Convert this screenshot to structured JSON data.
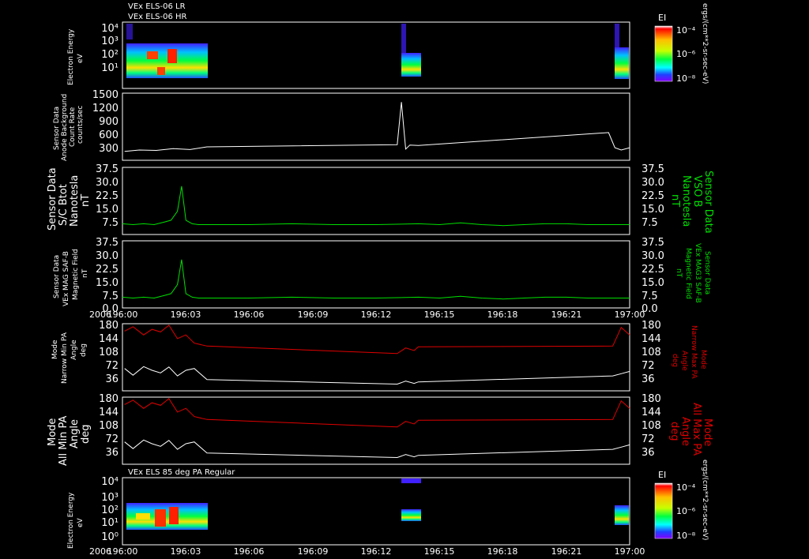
{
  "header": {
    "line1": "VEx ELS-06 LR",
    "line2": "VEx ELS-06 HR"
  },
  "spectro2_title": "VEx ELS 85 deg PA Regular",
  "xaxis": {
    "year": "2006",
    "ticks": [
      "196:00",
      "196:03",
      "196:06",
      "196:09",
      "196:12",
      "196:15",
      "196:18",
      "196:21",
      "197:00"
    ]
  },
  "colorbar": {
    "label": "EI",
    "units": "ergs/(cm**2-sr-sec-eV)",
    "ticks": [
      "10⁻⁴",
      "10⁻⁶",
      "10⁻⁸"
    ]
  },
  "panels": {
    "spec1": {
      "ylabel": [
        "Electron Energy",
        "eV"
      ],
      "yticks": [
        "10⁴",
        "10³",
        "10²",
        "10¹",
        "10"
      ]
    },
    "sensor": {
      "ylabel": [
        "Sensor Data",
        "Anode Background",
        "Count Rate",
        "counts/sec"
      ],
      "yticks": [
        "1500",
        "1200",
        "900",
        "600",
        "300"
      ]
    },
    "bmag1": {
      "ylabel_left": [
        "Sensor Data",
        "S/C Btot",
        "Nanotesla",
        "nT"
      ],
      "ylabel_right": [
        "Sensor Data",
        "VSO B",
        "Nanotesla",
        "nT"
      ],
      "yticks": [
        "37.5",
        "30.0",
        "22.5",
        "15.0",
        "7.5"
      ]
    },
    "bmag2": {
      "ylabel_left": [
        "Sensor Data",
        "VEx MAG SAF-B",
        "Magnetic Field",
        "nT"
      ],
      "ylabel_right": [
        "Sensor Data",
        "VEx MAG3 SAF-B",
        "Magnetic Field",
        "nT"
      ],
      "yticks": [
        "37.5",
        "30.0",
        "22.5",
        "15.0",
        "7.5",
        "0.0"
      ]
    },
    "pa1": {
      "ylabel_left": [
        "Mode",
        "Narrow Min PA",
        "Angle",
        "deg"
      ],
      "ylabel_right": [
        "Mode",
        "Narrow Max PA",
        "Angle",
        "deg"
      ],
      "yticks": [
        "180",
        "144",
        "108",
        "72",
        "36"
      ]
    },
    "pa2": {
      "ylabel_left": [
        "Mode",
        "All Min PA",
        "Angle",
        "deg"
      ],
      "ylabel_right": [
        "Mode",
        "All Max PA",
        "Angle",
        "deg"
      ],
      "yticks": [
        "180",
        "144",
        "108",
        "72",
        "36"
      ]
    },
    "spec2": {
      "ylabel": [
        "Electron Energy",
        "eV"
      ],
      "yticks": [
        "10⁴",
        "10³",
        "10²",
        "10¹",
        "10⁰"
      ]
    }
  },
  "colors": {
    "green": "#00e000",
    "red": "#e00000",
    "white": "#ffffff"
  },
  "chart_data": {
    "type": "line",
    "time_range_hours": [
      0,
      24
    ],
    "series_btot": {
      "x": [
        0,
        0.5,
        1,
        1.5,
        2,
        2.3,
        2.6,
        2.8,
        3,
        3.3,
        3.6,
        4,
        6,
        8,
        10,
        12,
        14,
        15,
        16,
        17,
        18,
        19,
        20,
        21,
        22,
        23,
        24
      ],
      "y": [
        6,
        5.5,
        6,
        5.5,
        7,
        8,
        13,
        27,
        8,
        6,
        5.5,
        5.5,
        5.5,
        6,
        5.5,
        5.5,
        6,
        5.5,
        6.5,
        5.5,
        5,
        5.5,
        6,
        6,
        5.5,
        5.5,
        5.5
      ],
      "ylim": [
        0,
        37.5
      ]
    },
    "series_counts": {
      "x": [
        0.1,
        0.8,
        1.6,
        2.4,
        3.2,
        4.0,
        13.0,
        13.2,
        13.4,
        13.6,
        14.0,
        23.0,
        23.3,
        23.6,
        24
      ],
      "y": [
        200,
        230,
        220,
        260,
        240,
        300,
        350,
        1300,
        250,
        340,
        330,
        620,
        280,
        230,
        280
      ],
      "ylim": [
        0,
        1500
      ]
    },
    "series_pa_max": {
      "x": [
        0.1,
        0.5,
        1,
        1.4,
        1.8,
        2.2,
        2.6,
        3,
        3.4,
        4,
        13,
        13.4,
        13.8,
        14,
        23.2,
        23.6,
        24
      ],
      "y": [
        160,
        172,
        150,
        165,
        158,
        176,
        140,
        150,
        128,
        120,
        100,
        115,
        108,
        118,
        120,
        170,
        150
      ],
      "ylim": [
        0,
        180
      ]
    },
    "series_pa_min": {
      "x": [
        0.1,
        0.5,
        1,
        1.4,
        1.8,
        2.2,
        2.6,
        3,
        3.4,
        4,
        13,
        13.4,
        13.8,
        14,
        23.2,
        23.6,
        24
      ],
      "y": [
        60,
        42,
        65,
        55,
        48,
        64,
        40,
        55,
        60,
        30,
        18,
        26,
        20,
        24,
        40,
        46,
        52
      ],
      "ylim": [
        0,
        180
      ]
    }
  }
}
